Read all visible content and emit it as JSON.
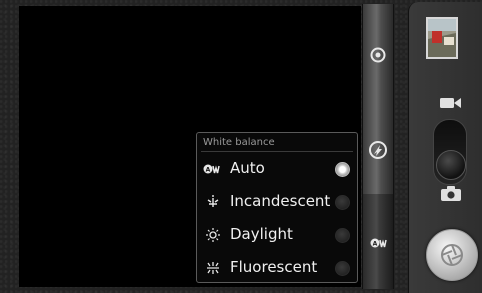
{
  "white_balance_menu": {
    "title": "White balance",
    "options": [
      {
        "label": "Auto",
        "icon": "auto-wb-icon",
        "selected": true
      },
      {
        "label": "Incandescent",
        "icon": "incandescent-icon",
        "selected": false
      },
      {
        "label": "Daylight",
        "icon": "daylight-icon",
        "selected": false
      },
      {
        "label": "Fluorescent",
        "icon": "fluorescent-icon",
        "selected": false
      }
    ]
  },
  "settings_strip": {
    "buttons": [
      "settings-knob-icon",
      "flash-mode-icon",
      "white-balance-icon"
    ]
  },
  "control_panel": {
    "mode_switch": {
      "options": [
        "video-camera-icon",
        "still-camera-icon"
      ],
      "selected": "still-camera-icon"
    },
    "shutter_icon": "shutter-icon",
    "thumbnail": "last-photo-thumbnail"
  },
  "colors": {
    "viewfinder": "#000000",
    "popup_background": "#0a0a0a",
    "popup_border": "#5a5a5a",
    "title_text": "#9a9a9a",
    "option_text": "#f0f0f0"
  }
}
